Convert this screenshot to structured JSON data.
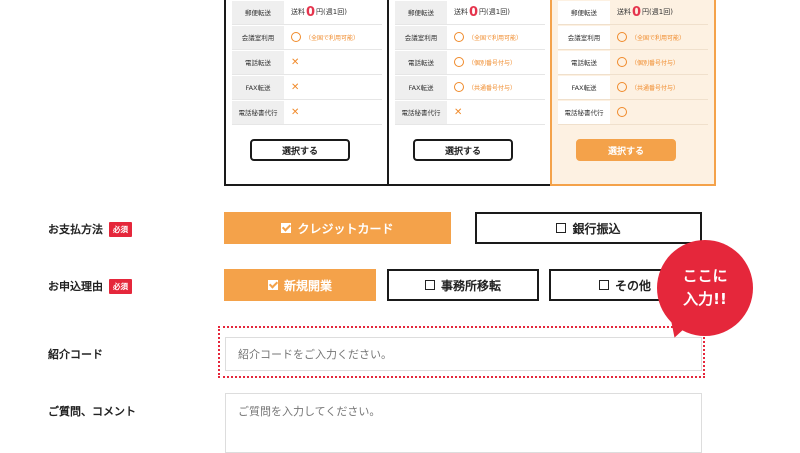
{
  "plans": [
    {
      "rows": [
        {
          "label": "郵便転送",
          "value_prefix": "送料",
          "value_big": "0",
          "value_suffix": "円(週1回)"
        },
        {
          "label": "会議室利用",
          "note": "（全国で利用可能）"
        },
        {
          "label": "電話転送",
          "mark": "✕"
        },
        {
          "label": "FAX転送",
          "mark": "✕"
        },
        {
          "label": "電話秘書代行",
          "mark": "✕"
        }
      ],
      "button": "選択する"
    },
    {
      "rows": [
        {
          "label": "郵便転送",
          "value_prefix": "送料",
          "value_big": "0",
          "value_suffix": "円(週1回)"
        },
        {
          "label": "会議室利用",
          "note": "（全国で利用可能）"
        },
        {
          "label": "電話転送",
          "note": "（個別番号付与）"
        },
        {
          "label": "FAX転送",
          "note": "（共通番号付与）"
        },
        {
          "label": "電話秘書代行",
          "mark": "✕"
        }
      ],
      "button": "選択する"
    },
    {
      "rows": [
        {
          "label": "郵便転送",
          "value_prefix": "送料",
          "value_big": "0",
          "value_suffix": "円(週1回)"
        },
        {
          "label": "会議室利用",
          "note": "（全国で利用可能）"
        },
        {
          "label": "電話転送",
          "note": "（個別番号付与）"
        },
        {
          "label": "FAX転送",
          "note": "（共通番号付与）"
        },
        {
          "label": "電話秘書代行",
          "note": ""
        }
      ],
      "button": "選択する"
    }
  ],
  "payment": {
    "label": "お支払方法",
    "required": "必須",
    "options": [
      "クレジットカード",
      "銀行振込"
    ]
  },
  "reason": {
    "label": "お申込理由",
    "required": "必須",
    "options": [
      "新規開業",
      "事務所移転",
      "その他"
    ]
  },
  "referral": {
    "label": "紹介コード",
    "placeholder": "紹介コードをご入力ください。"
  },
  "question": {
    "label": "ご質問、コメント",
    "placeholder": "ご質問を入力してください。"
  },
  "callout": {
    "line1": "ここに",
    "line2": "入力!!"
  },
  "colors": {
    "accent": "#f4a24a",
    "required": "#e5273b",
    "price": "#e5344d"
  }
}
